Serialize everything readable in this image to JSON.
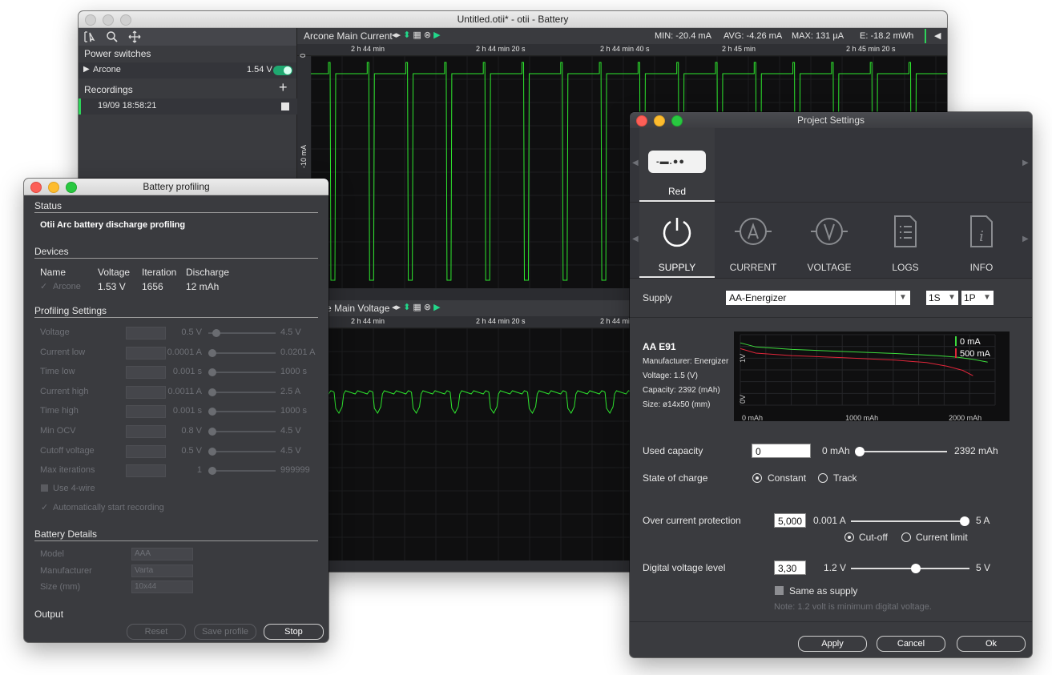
{
  "main_window": {
    "title": "Untitled.otii* - otii - Battery",
    "sidebar": {
      "power_switches": "Power switches",
      "device_name": "Arcone",
      "device_voltage": "1.54 V",
      "recordings": "Recordings",
      "add": "+",
      "recording_item": "19/09 18:58:21"
    },
    "current_chart": {
      "title": "Arcone Main Current",
      "min": "MIN: -20.4 mA",
      "avg": "AVG: -4.26 mA",
      "max": "MAX: 131 µA",
      "energy": "E: -18.2 mWh",
      "ticks": [
        "2 h 44 min",
        "2 h 44 min 20 s",
        "2 h 44 min 40 s",
        "2 h 45 min",
        "2 h 45 min 20 s"
      ],
      "y_top": "0",
      "y_mid": "-10 mA"
    },
    "voltage_chart": {
      "title": "e Main Voltage",
      "ticks": [
        "2 h 44 min",
        "2 h 44 min 20 s",
        "2 h 44 min"
      ]
    }
  },
  "battery_profiling": {
    "title": "Battery profiling",
    "status_heading": "Status",
    "status_text": "Otii Arc battery discharge profiling",
    "devices_heading": "Devices",
    "columns": [
      "Name",
      "Voltage",
      "Iteration",
      "Discharge"
    ],
    "device_row": {
      "name": "Arcone",
      "voltage": "1.53 V",
      "iteration": "1656",
      "discharge": "12 mAh"
    },
    "settings_heading": "Profiling Settings",
    "settings": [
      {
        "label": "Voltage",
        "value": "0.5 V",
        "max": "4.5 V",
        "pos": 0.06
      },
      {
        "label": "Current low",
        "value": "0.0001 A",
        "max": "0.0201 A",
        "pos": 0.0
      },
      {
        "label": "Time low",
        "value": "0.001 s",
        "max": "1000 s",
        "pos": 0.0
      },
      {
        "label": "Current high",
        "value": "0.0011 A",
        "max": "2.5 A",
        "pos": 0.0
      },
      {
        "label": "Time high",
        "value": "0.001 s",
        "max": "1000 s",
        "pos": 0.0
      },
      {
        "label": "Min OCV",
        "value": "0.8 V",
        "max": "4.5 V",
        "pos": 0.0
      },
      {
        "label": "Cutoff voltage",
        "value": "0.5 V",
        "max": "4.5 V",
        "pos": 0.0
      },
      {
        "label": "Max iterations",
        "value": "1",
        "max": "999999",
        "pos": 0.0
      }
    ],
    "use_4wire": "Use 4-wire",
    "auto_start": "Automatically start recording",
    "battery_details_heading": "Battery Details",
    "details": [
      {
        "label": "Model",
        "value": "AAA"
      },
      {
        "label": "Manufacturer",
        "value": "Varta"
      },
      {
        "label": "Size (mm)",
        "value": "10x44"
      }
    ],
    "output_heading": "Output",
    "buttons": {
      "reset": "Reset",
      "save_profile": "Save profile",
      "stop": "Stop"
    }
  },
  "project_settings": {
    "title": "Project Settings",
    "device_label": "Red",
    "tabs": [
      "SUPPLY",
      "CURRENT",
      "VOLTAGE",
      "LOGS",
      "INFO"
    ],
    "supply_label": "Supply",
    "supply_value": "AA-Energizer",
    "series_value": "1S",
    "parallel_value": "1P",
    "battery": {
      "name": "AA E91",
      "manufacturer": "Manufacturer: Energizer",
      "voltage": "Voltage: 1.5 (V)",
      "capacity": "Capacity: 2392 (mAh)",
      "size": "Size: ø14x50 (mm)"
    },
    "used_capacity_label": "Used capacity",
    "used_capacity_value": "0",
    "used_capacity_min": "0 mAh",
    "used_capacity_max": "2392 mAh",
    "used_capacity_fraction": 0.0,
    "state_of_charge_label": "State of charge",
    "soc_constant": "Constant",
    "soc_track": "Track",
    "ocp_label": "Over current protection",
    "ocp_value": "5,000",
    "ocp_min": "0.001 A",
    "ocp_max": "5 A",
    "ocp_fraction": 1.0,
    "cutoff": "Cut-off",
    "current_limit": "Current limit",
    "dvl_label": "Digital voltage level",
    "dvl_value": "3,30",
    "dvl_min": "1.2 V",
    "dvl_max": "5 V",
    "dvl_fraction": 0.55,
    "same_as_supply": "Same as supply",
    "note": "Note: 1.2 volt is minimum digital voltage.",
    "buttons": {
      "apply": "Apply",
      "cancel": "Cancel",
      "ok": "Ok"
    }
  },
  "chart_data": {
    "type": "line",
    "x_ticks": [
      "0 mAh",
      "1000 mAh",
      "2000 mAh"
    ],
    "y_ticks": [
      "1V",
      "0V"
    ],
    "xlim": [
      0,
      2392
    ],
    "series": [
      {
        "name": "0 mA",
        "color": "#3ddc3d",
        "x": [
          0,
          150,
          500,
          1000,
          1500,
          1900,
          2100,
          2250,
          2392
        ],
        "y": [
          1.52,
          1.42,
          1.36,
          1.31,
          1.26,
          1.21,
          1.17,
          1.12,
          1.05
        ]
      },
      {
        "name": "500 mA",
        "color": "#e0263a",
        "x": [
          0,
          150,
          500,
          1000,
          1500,
          1800,
          2000,
          2150,
          2250
        ],
        "y": [
          1.38,
          1.27,
          1.21,
          1.16,
          1.1,
          1.04,
          0.95,
          0.85,
          0.72
        ]
      }
    ]
  }
}
